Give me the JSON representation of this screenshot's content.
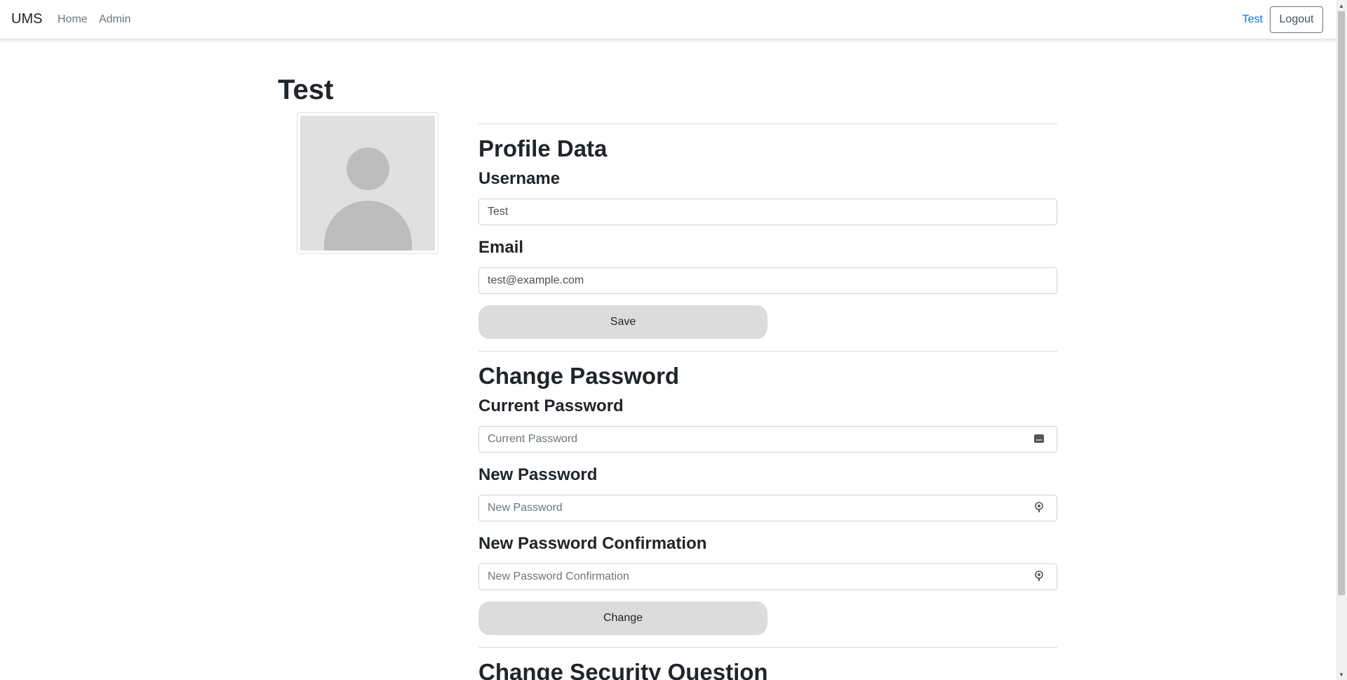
{
  "nav": {
    "brand": "UMS",
    "links": [
      "Home",
      "Admin"
    ],
    "user": "Test",
    "logout": "Logout"
  },
  "page": {
    "title": "Test"
  },
  "profile": {
    "heading": "Profile Data",
    "username_label": "Username",
    "username_value": "Test",
    "email_label": "Email",
    "email_value": "test@example.com",
    "save_label": "Save"
  },
  "password": {
    "heading": "Change Password",
    "current_label": "Current Password",
    "current_placeholder": "Current Password",
    "new_label": "New Password",
    "new_placeholder": "New Password",
    "confirm_label": "New Password Confirmation",
    "confirm_placeholder": "New Password Confirmation",
    "change_label": "Change"
  },
  "security": {
    "heading": "Change Security Question"
  }
}
